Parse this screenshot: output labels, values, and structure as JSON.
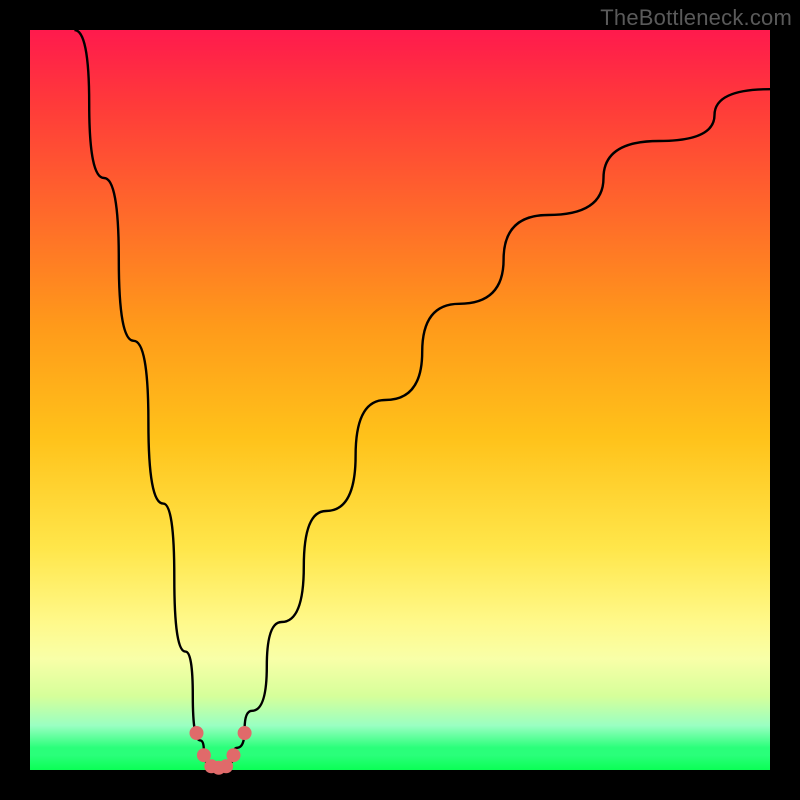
{
  "watermark": "TheBottleneck.com",
  "domain_hint": "Chart",
  "chart_data": {
    "type": "line",
    "title": "",
    "xlabel": "",
    "ylabel": "",
    "xlim": [
      0,
      100
    ],
    "ylim": [
      0,
      100
    ],
    "x_note": "x is normalized component score (0-100), optimum at ~25",
    "y_note": "y is bottleneck percentage (0-100), 0 = no bottleneck",
    "background_gradient_note": "vertical gradient: red (high bottleneck) at top to green (no bottleneck) at bottom",
    "series": [
      {
        "name": "bottleneck-curve",
        "x": [
          6,
          10,
          14,
          18,
          21,
          23,
          24,
          25,
          26,
          27,
          28,
          30,
          34,
          40,
          48,
          58,
          70,
          85,
          100
        ],
        "values": [
          100,
          80,
          58,
          36,
          16,
          4,
          1,
          0,
          0,
          1,
          3,
          8,
          20,
          35,
          50,
          63,
          75,
          85,
          92
        ]
      }
    ],
    "markers": {
      "name": "highlight-dots",
      "color": "#e06a6a",
      "points": [
        {
          "x": 22.5,
          "y": 5
        },
        {
          "x": 23.5,
          "y": 2
        },
        {
          "x": 24.5,
          "y": 0.5
        },
        {
          "x": 25.5,
          "y": 0.3
        },
        {
          "x": 26.5,
          "y": 0.5
        },
        {
          "x": 27.5,
          "y": 2
        },
        {
          "x": 29.0,
          "y": 5
        }
      ]
    }
  }
}
